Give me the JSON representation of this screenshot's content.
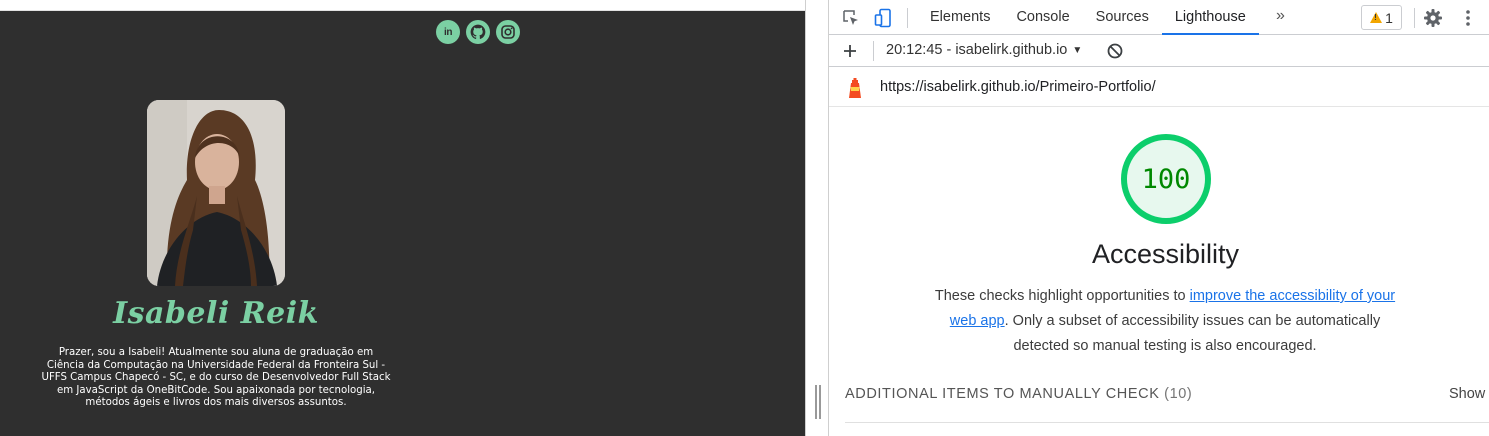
{
  "portfolio": {
    "name": "Isabeli Reik",
    "bio": "Prazer, sou a Isabeli! Atualmente sou aluna de graduação em Ciência da Computação na Universidade Federal da Fronteira Sul - UFFS Campus Chapecó - SC, e do curso de Desenvolvedor Full Stack em JavaScript da OneBitCode. Sou apaixonada por tecnologia, métodos ágeis e livros dos mais diversos assuntos.",
    "social_icons": [
      "linkedin-icon",
      "github-icon",
      "instagram-icon"
    ],
    "linkedin_glyph": "in",
    "accent_color": "#7bd0a3",
    "background_color": "#2f2f2f"
  },
  "devtools": {
    "tabs": [
      "Elements",
      "Console",
      "Sources",
      "Lighthouse"
    ],
    "active_tab": "Lighthouse",
    "more_tabs_glyph": "»",
    "warnings_count": "1",
    "report_selector": "20:12:45 - isabelirk.github.io",
    "report_url": "https://isabelirk.github.io/Primeiro-Portfolio/",
    "score": "100",
    "category_title": "Accessibility",
    "description_prefix": "These checks highlight opportunities to ",
    "description_link": "improve the accessibility of your web app",
    "description_suffix": ". Only a subset of accessibility issues can be automatically detected so manual testing is also encouraged.",
    "manual_label": "ADDITIONAL ITEMS TO MANUALLY CHECK",
    "manual_count": "(10)",
    "show_label": "Show",
    "score_color": "#0cce6b",
    "link_color": "#1a73e8"
  }
}
